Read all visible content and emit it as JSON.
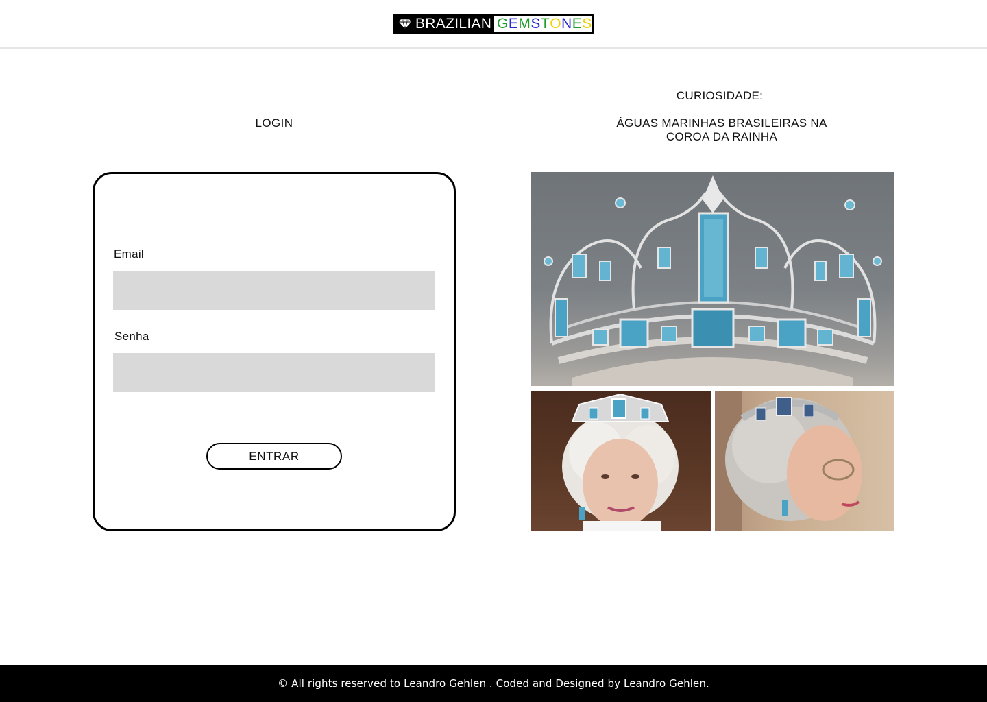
{
  "brand": {
    "left": "BRAZILIAN",
    "right_letters": [
      {
        "ch": "G",
        "color": "#1f9d2b"
      },
      {
        "ch": "E",
        "color": "#2a2ad0"
      },
      {
        "ch": "M",
        "color": "#1f9d2b"
      },
      {
        "ch": "S",
        "color": "#2a2ad0"
      },
      {
        "ch": "T",
        "color": "#1f9d2b"
      },
      {
        "ch": "O",
        "color": "#f2d100"
      },
      {
        "ch": "N",
        "color": "#2a2ad0"
      },
      {
        "ch": "E",
        "color": "#1f9d2b"
      },
      {
        "ch": "S",
        "color": "#f2d100"
      }
    ],
    "icon": "diamond-icon"
  },
  "login": {
    "title": "LOGIN",
    "email_label": "Email",
    "email_value": "",
    "password_label": "Senha",
    "password_value": "",
    "submit_label": "ENTRAR"
  },
  "curiosity": {
    "label": "CURIOSIDADE:",
    "title": "ÁGUAS MARINHAS BRASILEIRAS NA COROA DA RAINHA",
    "images": [
      "aquamarine-tiara-photo",
      "queen-wearing-tiara-photo",
      "queen-profile-tiara-photo"
    ]
  },
  "footer": {
    "text": "© All rights reserved to Leandro Gehlen . Coded  and Designed by Leandro Gehlen."
  },
  "colors": {
    "input_bg": "#d9d9d9",
    "footer_bg": "#000000",
    "aquamarine": "#4aa3c4"
  }
}
